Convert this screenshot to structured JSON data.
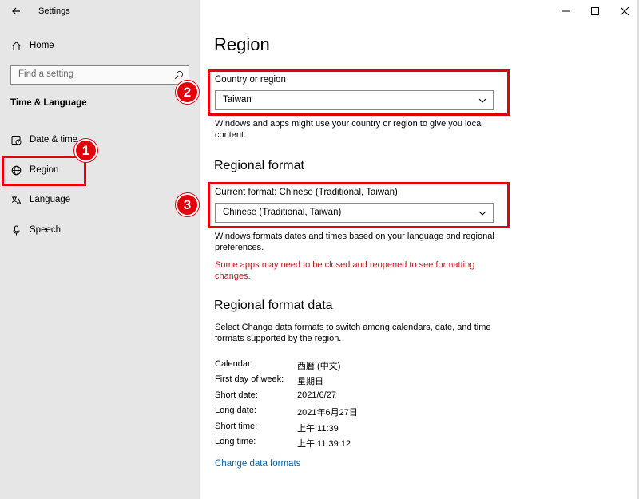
{
  "window": {
    "title": "Settings",
    "controls": {
      "minimize": "─",
      "maximize": "☐",
      "close": "✕"
    }
  },
  "sidebar": {
    "home_label": "Home",
    "search_placeholder": "Find a setting",
    "section_title": "Time & Language",
    "items": [
      {
        "label": "Date & time",
        "icon": "calendar-clock-icon"
      },
      {
        "label": "Region",
        "icon": "globe-icon"
      },
      {
        "label": "Language",
        "icon": "language-icon"
      },
      {
        "label": "Speech",
        "icon": "microphone-icon"
      }
    ]
  },
  "main": {
    "title": "Region",
    "country": {
      "label": "Country or region",
      "value": "Taiwan",
      "description": "Windows and apps might use your country or region to give you local content."
    },
    "regional_format": {
      "heading": "Regional format",
      "label": "Current format: Chinese (Traditional, Taiwan)",
      "value": "Chinese (Traditional, Taiwan)",
      "description": "Windows formats dates and times based on your language and regional preferences.",
      "warning": "Some apps may need to be closed and reopened to see formatting changes."
    },
    "format_data": {
      "heading": "Regional format data",
      "description": "Select Change data formats to switch among calendars, date, and time formats supported by the region.",
      "rows": [
        {
          "key": "Calendar:",
          "value": "西曆 (中文)"
        },
        {
          "key": "First day of week:",
          "value": "星期日"
        },
        {
          "key": "Short date:",
          "value": "2021/6/27"
        },
        {
          "key": "Long date:",
          "value": "2021年6月27日"
        },
        {
          "key": "Short time:",
          "value": "上午 11:39"
        },
        {
          "key": "Long time:",
          "value": "上午 11:39:12"
        }
      ],
      "link": "Change data formats"
    }
  },
  "annotations": {
    "badge1": "1",
    "badge2": "2",
    "badge3": "3",
    "color": "#e3000b"
  },
  "colors": {
    "sidebar_bg": "#e6e6e6",
    "link": "#0063b1",
    "warning": "#c0141f"
  }
}
